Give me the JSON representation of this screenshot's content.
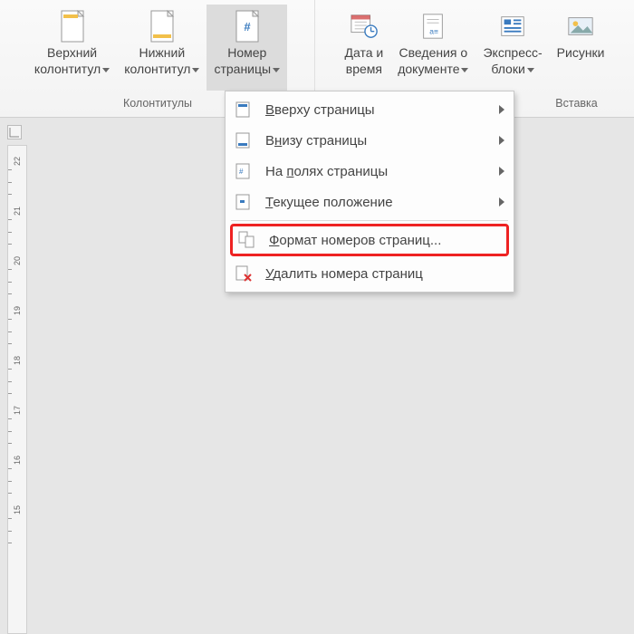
{
  "ribbon": {
    "groups": [
      {
        "name": "Колонтитулы",
        "buttons": [
          {
            "label1": "Верхний",
            "label2": "колонтитул",
            "hasCaret": true
          },
          {
            "label1": "Нижний",
            "label2": "колонтитул",
            "hasCaret": true
          },
          {
            "label1": "Номер",
            "label2": "страницы",
            "hasCaret": true,
            "active": true
          }
        ]
      },
      {
        "name": "Вставка",
        "buttons": [
          {
            "label1": "Дата и",
            "label2": "время"
          },
          {
            "label1": "Сведения о",
            "label2": "документе",
            "hasCaret": true
          },
          {
            "label1": "Экспресс-",
            "label2": "блоки",
            "hasCaret": true
          },
          {
            "label1": "Рисунки",
            "label2": ""
          }
        ]
      }
    ]
  },
  "menu": {
    "items": [
      {
        "label": "Вверху страницы",
        "ukey": "В",
        "rest": "верху страницы",
        "hasSub": true
      },
      {
        "label": "Внизу страницы",
        "ukey": "н",
        "pre": "В",
        "rest": "изу страницы",
        "hasSub": true
      },
      {
        "label": "На полях страницы",
        "ukey": "п",
        "pre": "На ",
        "rest": "олях страницы",
        "hasSub": true
      },
      {
        "label": "Текущее положение",
        "ukey": "Т",
        "rest": "екущее положение",
        "hasSub": true
      },
      {
        "label": "Формат номеров страниц...",
        "ukey": "Ф",
        "rest": "ормат номеров страниц...",
        "highlighted": true
      },
      {
        "label": "Удалить номера страниц",
        "ukey": "У",
        "rest": "далить номера страниц"
      }
    ]
  },
  "ruler": {
    "marks": [
      "22",
      "21",
      "20",
      "19",
      "18",
      "17",
      "16",
      "15"
    ]
  }
}
